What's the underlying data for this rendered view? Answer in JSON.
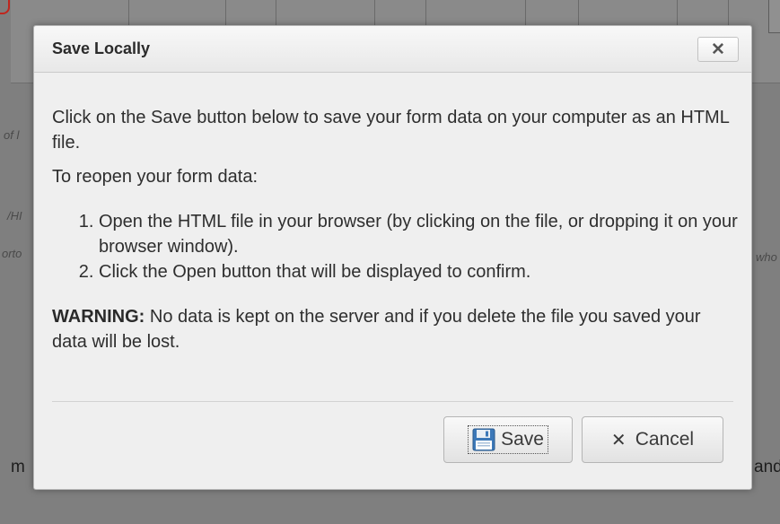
{
  "background": {
    "partial_text_left_1": "of l",
    "partial_text_left_2": "/HI",
    "partial_text_left_3": "orto",
    "partial_text_right_1": "who",
    "partial_text_bottom_left": "m",
    "partial_text_bottom_right": "and"
  },
  "dialog": {
    "title": "Save Locally",
    "close_label": "✕",
    "intro": "Click on the Save button below to save your form data on your computer as an HTML file.",
    "reopen_heading": "To reopen your form data:",
    "steps": [
      "Open the HTML file in your browser (by clicking on the file, or dropping it on your browser window).",
      "Click the Open button that will be displayed to confirm."
    ],
    "warning_label": "WARNING:",
    "warning_text": " No data is kept on the server and if you delete the file you saved your data will be lost.",
    "save_label": "Save",
    "cancel_icon": "✕",
    "cancel_label": "Cancel"
  },
  "colors": {
    "overlay": "#7f7f7f",
    "dialog_bg": "#efefef",
    "accent_red": "#c0261e"
  }
}
